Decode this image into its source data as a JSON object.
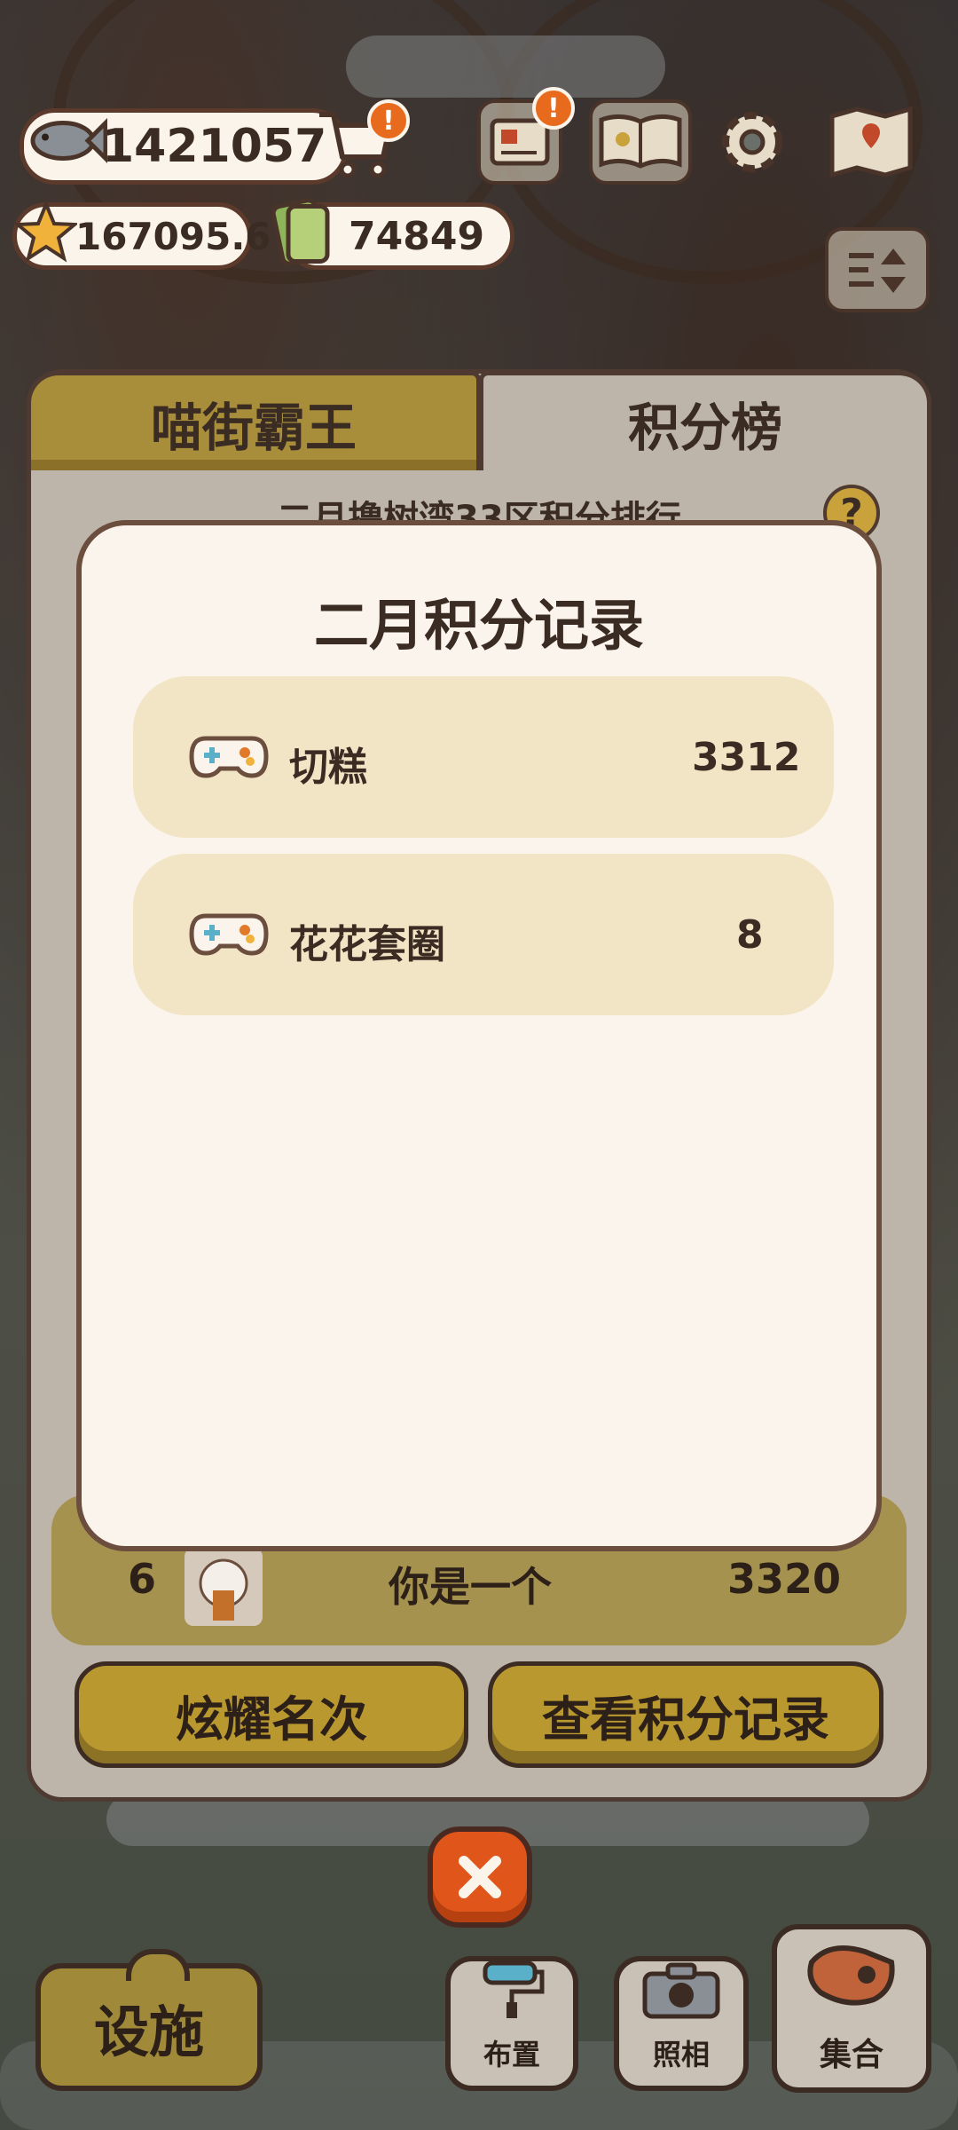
{
  "hud": {
    "fish_count": "1421057",
    "star_count": "167095.6",
    "ticket_count": "74849",
    "shop_alert": "!",
    "mail_alert": "!"
  },
  "tabs": {
    "left": "喵街霸王",
    "right": "积分榜"
  },
  "leaderboard": {
    "title_partial": "二月撸树湾33区积分排行",
    "help": "?",
    "my_rank": {
      "rank": "6",
      "name": "你是一个",
      "score": "3320"
    },
    "show_rank_button": "炫耀名次",
    "view_records_button": "查看积分记录"
  },
  "modal": {
    "title": "二月积分记录",
    "records": [
      {
        "game": "切糕",
        "score": "3312"
      },
      {
        "game": "花花套圈",
        "score": "8"
      }
    ]
  },
  "bottom_bar": {
    "facility": "设施",
    "layout": "布置",
    "photo": "照相",
    "gather": "集合"
  },
  "colors": {
    "accent_orange": "#e0561a",
    "gold": "#b9982f",
    "card_bg": "#fbf4ec",
    "record_bg": "#f2e5c6",
    "outline": "#4e3a30"
  },
  "icons": [
    "fish-icon",
    "cart-icon",
    "star-icon",
    "ticket-icon",
    "mail-icon",
    "book-icon",
    "gear-icon",
    "map-icon",
    "sort-icon",
    "gamepad-icon",
    "close-icon",
    "paint-roller-icon",
    "camera-icon",
    "whistle-icon"
  ]
}
